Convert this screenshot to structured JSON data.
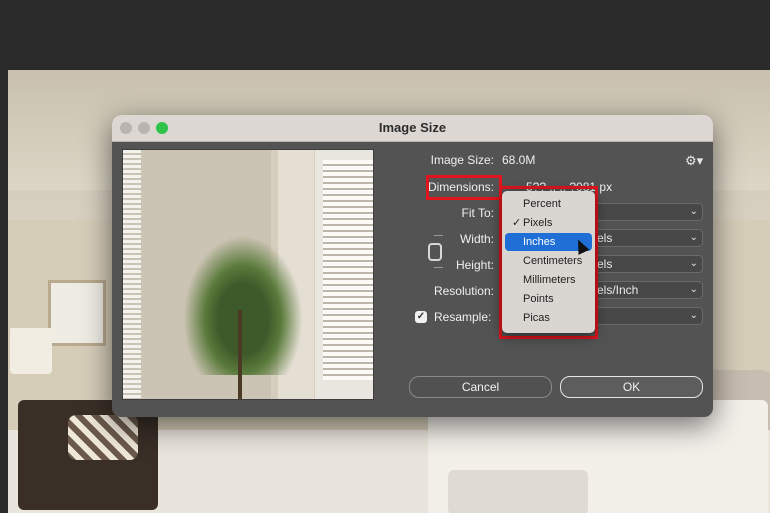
{
  "dialog": {
    "title": "Image Size",
    "image_size_label": "Image Size:",
    "image_size_value": "68.0M",
    "dimensions_label": "Dimensions:",
    "dimensions_value": "5?? .. .. ?081 px",
    "fit_to_label": "Fit To:",
    "width_label": "Width:",
    "width_unit": "els",
    "height_label": "Height:",
    "height_unit": "els",
    "resolution_label": "Resolution:",
    "resolution_unit": "els/Inch",
    "resample_label": "Resample:",
    "resample_checked": true,
    "cancel_label": "Cancel",
    "ok_label": "OK"
  },
  "menu": {
    "items": [
      {
        "label": "Percent",
        "checked": false,
        "selected": false
      },
      {
        "label": "Pixels",
        "checked": true,
        "selected": false
      },
      {
        "label": "Inches",
        "checked": false,
        "selected": true
      },
      {
        "label": "Centimeters",
        "checked": false,
        "selected": false
      },
      {
        "label": "Millimeters",
        "checked": false,
        "selected": false
      },
      {
        "label": "Points",
        "checked": false,
        "selected": false
      },
      {
        "label": "Picas",
        "checked": false,
        "selected": false
      }
    ]
  },
  "colors": {
    "highlight": "#e0141c",
    "menu_selected": "#1f6fd6",
    "dialog_bg": "#535353"
  }
}
